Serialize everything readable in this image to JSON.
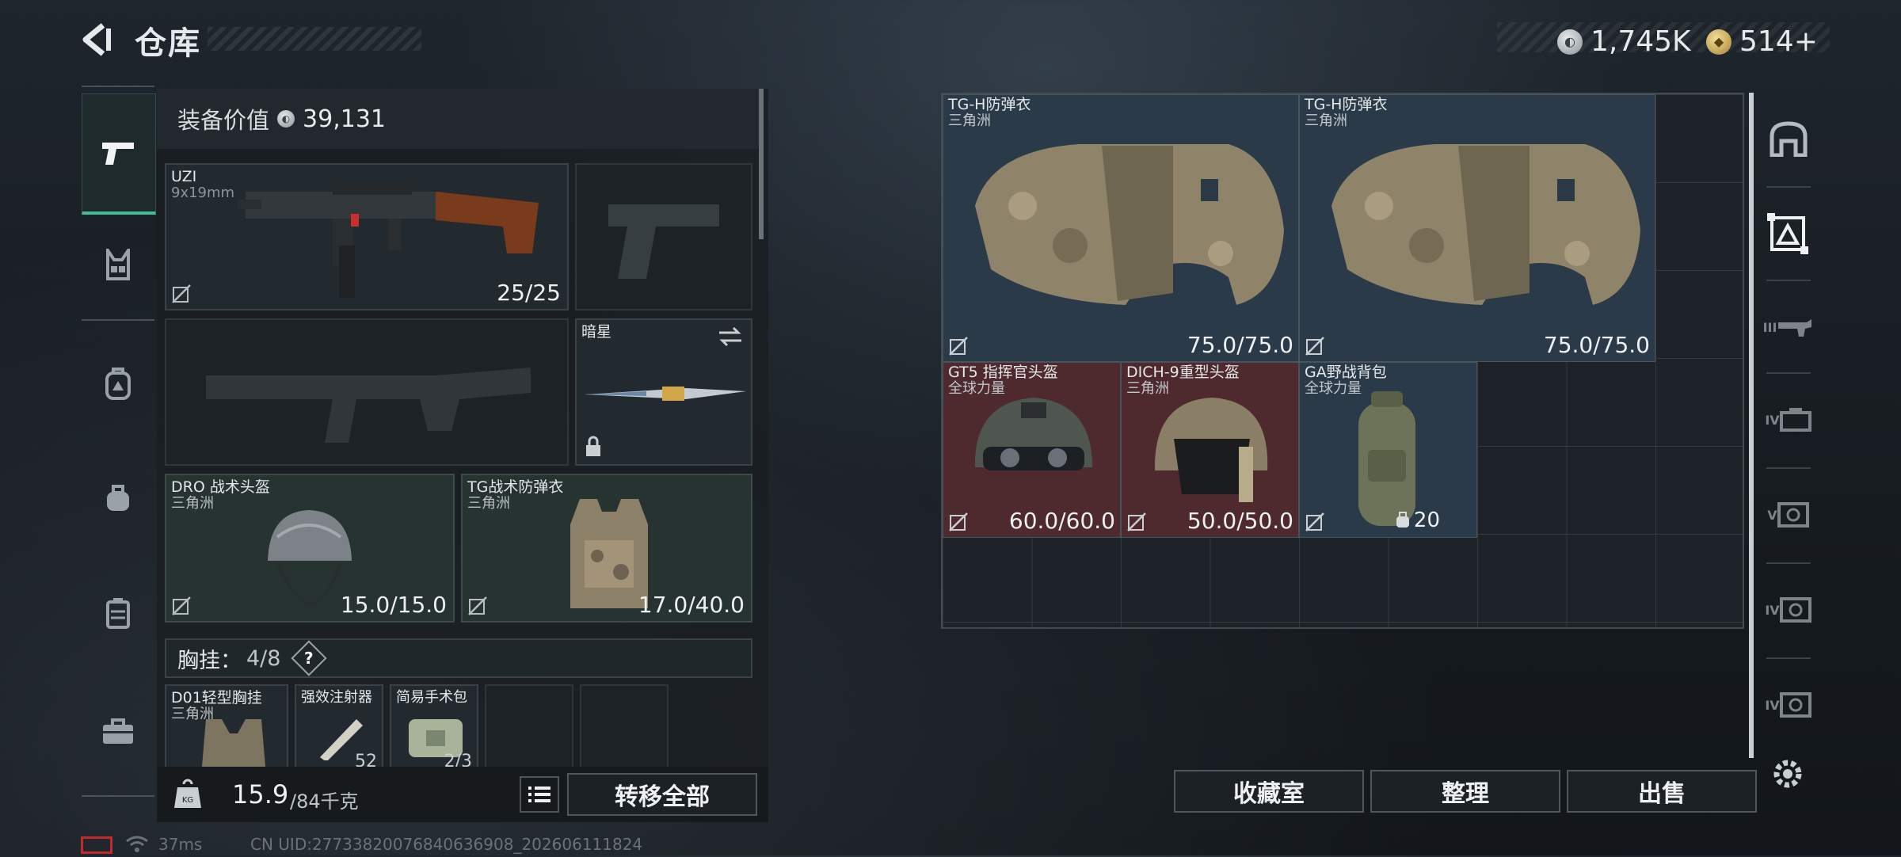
{
  "header": {
    "title": "仓库",
    "currency_silver": "1,745K",
    "currency_gold": "514+"
  },
  "left_nav": [
    "pistol-icon",
    "chest-rig-icon",
    "backpack-icon",
    "pouch-icon",
    "case-icon",
    "toolbox-icon"
  ],
  "loadout": {
    "value_label": "装备价值",
    "value": "39,131",
    "weapon_primary": {
      "name": "UZI",
      "caliber": "9x19mm",
      "durability": "25/25"
    },
    "melee": {
      "name": "暗星"
    },
    "helmet": {
      "name": "DRO 战术头盔",
      "source": "三角洲",
      "durability": "15.0/15.0"
    },
    "armor": {
      "name": "TG战术防弹衣",
      "source": "三角洲",
      "durability": "17.0/40.0"
    },
    "chest_rig": {
      "label": "胸挂：",
      "count": "4/8",
      "help": "?"
    },
    "rig_items": [
      {
        "name": "D01轻型胸挂",
        "source": "三角洲"
      },
      {
        "name": "强效注射器",
        "count": "52"
      },
      {
        "name": "简易手术包",
        "count": "2/3"
      }
    ],
    "weight": "15.9",
    "weight_max": "/84千克",
    "transfer_all": "转移全部"
  },
  "storage": {
    "items": [
      {
        "name": "TG-H防弹衣",
        "source": "三角洲",
        "durability": "75.0/75.0",
        "rarity": "blue"
      },
      {
        "name": "TG-H防弹衣",
        "source": "三角洲",
        "durability": "75.0/75.0",
        "rarity": "blue"
      },
      {
        "name": "GT5 指挥官头盔",
        "source": "全球力量",
        "durability": "60.0/60.0",
        "rarity": "red"
      },
      {
        "name": "DICH-9重型头盔",
        "source": "三角洲",
        "durability": "50.0/50.0",
        "rarity": "red"
      },
      {
        "name": "GA野战背包",
        "source": "全球力量",
        "capacity": "20",
        "rarity": "blue"
      }
    ]
  },
  "right_tabs": [
    "safe-icon",
    "grid-tab-icon",
    "III",
    "IV",
    "V",
    "IV",
    "IV"
  ],
  "buttons": {
    "collection": "收藏室",
    "sort": "整理",
    "sell": "出售"
  },
  "status": {
    "ping": "37ms",
    "uid": "CN UID:27733820076840636908_202606111824"
  },
  "colors": {
    "accent": "#3fbf94",
    "rarity_blue": "#2a3a48",
    "rarity_red": "#4e2a2f"
  }
}
